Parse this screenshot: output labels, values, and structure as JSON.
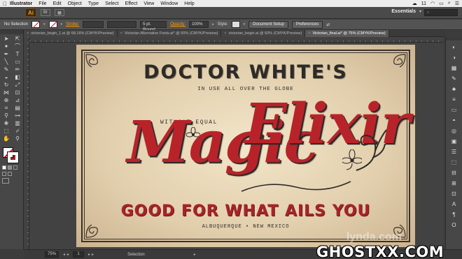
{
  "menubar": {
    "apple": "",
    "app_name": "Illustrator",
    "items": [
      "File",
      "Edit",
      "Object",
      "Type",
      "Select",
      "Effect",
      "View",
      "Window",
      "Help"
    ],
    "right_badge": "11"
  },
  "appbar": {
    "logo": "Ai",
    "bridge": "Br",
    "workspace": "Essentials",
    "search_placeholder": ""
  },
  "control": {
    "selection": "No Selection",
    "stroke_label": "Stroke:",
    "brush": "5 pt. Round",
    "opacity_label": "Opacity:",
    "opacity_value": "100%",
    "style_label": "Style:",
    "document_setup": "Document Setup",
    "preferences": "Preferences"
  },
  "tabs": [
    {
      "label": "victorian_begin_1.ai @ 68.16% (CMYK/Preview)",
      "active": false
    },
    {
      "label": "Victorian Alternative Fonts.ai* @ 50% (CMYK/Preview)",
      "active": false
    },
    {
      "label": "victorian_begin.ai @ 50% (CMYK/Preview)",
      "active": false
    },
    {
      "label": "Victorian_final.ai* @ 75% (CMYK/Preview)",
      "active": true
    }
  ],
  "tab_close": "×",
  "artwork": {
    "headline": "DOCTOR WHITE'S",
    "tagline": "IN USE ALL OVER THE GLOBE",
    "without": "WITHOUT EQUAL",
    "magic": "Magic",
    "elixir": "Elixir",
    "good": "GOOD FOR WHAT AILS YOU",
    "location": "ALBUQUERQUE • NEW MEXICO"
  },
  "watermark_lynda": "lynda.com",
  "status": {
    "zoom": "75%",
    "page": "1",
    "mode": "Selection"
  },
  "watermark": "GHOSTXX.COM",
  "colors": {
    "accent": "#ff9a00",
    "script_red": "#b8232a",
    "ink": "#2d2b28",
    "paper": "#e3d2b3"
  }
}
